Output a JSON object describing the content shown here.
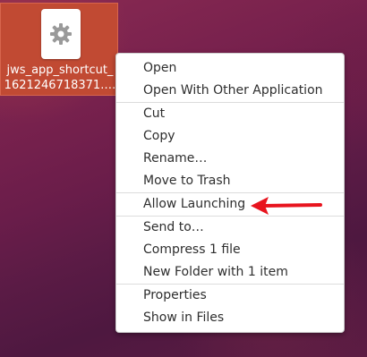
{
  "desktop": {
    "file_icon": {
      "name": "file-settings-icon",
      "label_line1": "jws_app_shortcut_",
      "label_line2": "1621246718371.…",
      "selected_color": "#c14a33"
    }
  },
  "context_menu": {
    "groups": [
      {
        "items": [
          "Open",
          "Open With Other Application"
        ]
      },
      {
        "items": [
          "Cut",
          "Copy",
          "Rename…",
          "Move to Trash"
        ]
      },
      {
        "items": [
          "Allow Launching"
        ]
      },
      {
        "items": [
          "Send to…",
          "Compress 1 file",
          "New Folder with 1 item"
        ]
      },
      {
        "items": [
          "Properties",
          "Show in Files"
        ]
      }
    ]
  },
  "annotation": {
    "arrow_color": "#e8141e",
    "points_to": "Allow Launching"
  }
}
